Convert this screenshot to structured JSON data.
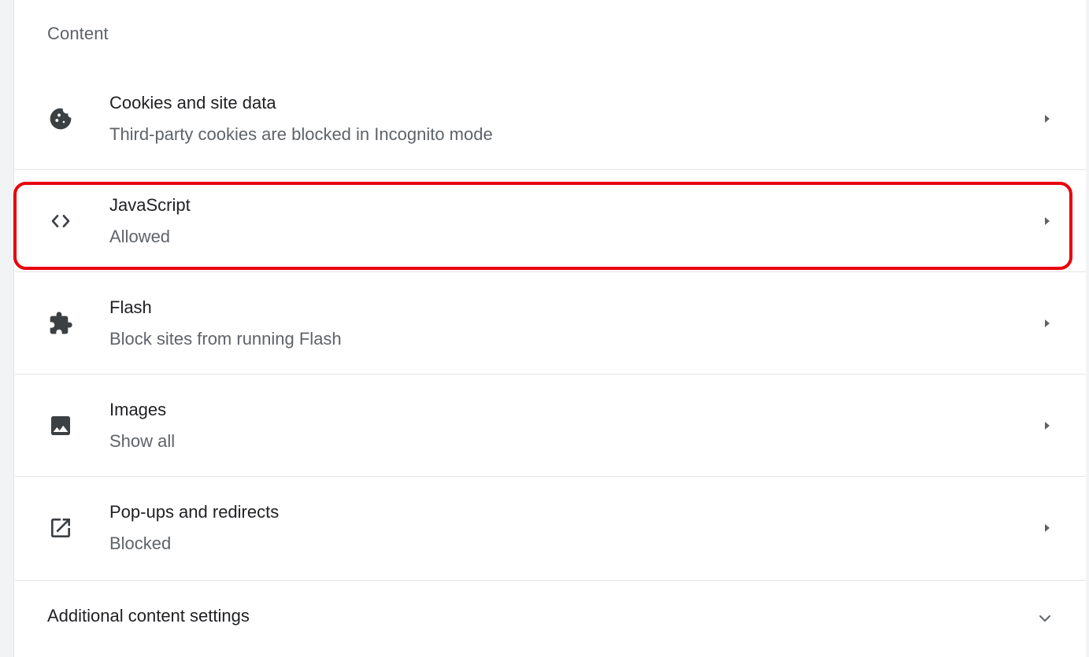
{
  "section": {
    "title": "Content"
  },
  "rows": [
    {
      "label": "Cookies and site data",
      "sublabel": "Third-party cookies are blocked in Incognito mode",
      "icon": "cookie-icon"
    },
    {
      "label": "JavaScript",
      "sublabel": "Allowed",
      "icon": "code-icon"
    },
    {
      "label": "Flash",
      "sublabel": "Block sites from running Flash",
      "icon": "puzzle-icon"
    },
    {
      "label": "Images",
      "sublabel": "Show all",
      "icon": "image-icon"
    },
    {
      "label": "Pop-ups and redirects",
      "sublabel": "Blocked",
      "icon": "open-in-new-icon"
    }
  ],
  "additional": {
    "label": "Additional content settings",
    "icon": "chevron-down-icon"
  },
  "colors": {
    "highlight": "#e8000b",
    "text_primary": "#202124",
    "text_secondary": "#5f6368",
    "icon": "#3c4043",
    "divider": "#e6e6e6"
  }
}
